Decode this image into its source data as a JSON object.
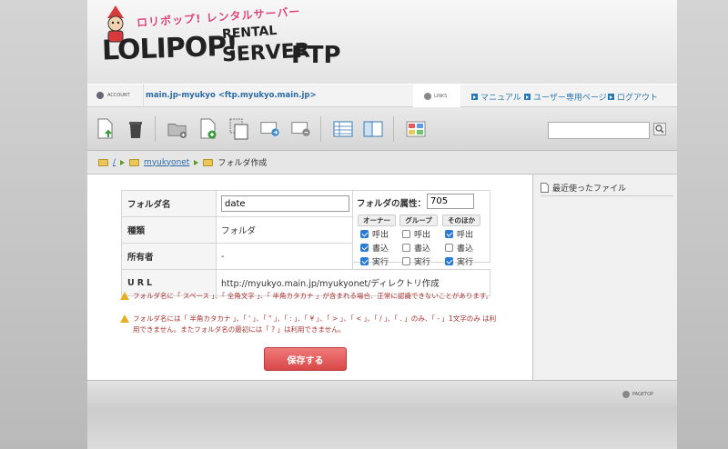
{
  "header": {
    "logo_tag": "ロリポップ! レンタルサーバー",
    "logo_main": "LOLIPOP!",
    "logo_rental": "RENTAL",
    "logo_server": "SERVER",
    "logo_ftp": "FTP"
  },
  "account": {
    "label": "ACCOUNT",
    "name": "main.jp-myukyo <ftp.myukyo.main.jp>"
  },
  "links": {
    "label": "LINKS",
    "items": [
      "マニュアル",
      "ユーザー専用ページ",
      "ログアウト"
    ]
  },
  "toolbar": {
    "icons": [
      "upload-file-icon",
      "trash-icon",
      "new-folder-icon",
      "new-file-icon",
      "copy-icon",
      "move-icon",
      "rename-icon",
      "list-view-icon",
      "split-view-icon",
      "tile-view-icon"
    ],
    "search_value": ""
  },
  "breadcrumb": {
    "root": "/",
    "folder": "myukyonet",
    "current": "フォルダ作成"
  },
  "form": {
    "name_label": "フォルダ名",
    "name_value": "date",
    "type_label": "種類",
    "type_value": "フォルダ",
    "owner_label": "所有者",
    "owner_value": "-",
    "url_label": "URL",
    "url_value": "http://myukyo.main.jp/myukyonet/ディレクトリ作成",
    "attr_label": "フォルダの属性：",
    "attr_value": "705",
    "columns": [
      "オーナー",
      "グループ",
      "そのほか"
    ],
    "perm_labels": [
      "呼出",
      "書込",
      "実行"
    ],
    "permissions": {
      "owner": [
        true,
        true,
        true
      ],
      "group": [
        false,
        false,
        false
      ],
      "other": [
        true,
        false,
        true
      ]
    }
  },
  "warnings": [
    "フォルダ名に「 スペース 」、「 全角文字 」、「 半角カタカナ 」が含まれる場合、正常に認識できないことがあります。",
    "フォルダ名には「 半角カタカナ 」、「 ' 」、「 \" 」、「 : 」、「 ¥ 」、「 > 」、「 < 」、「 / 」、「 . 」のみ、「 - 」1文字のみ は利用できません。またフォルダ名の最初には「 ? 」は利用できません。"
  ],
  "save_label": "保存する",
  "sidebar": {
    "recent_title": "最近使ったファイル"
  },
  "footer": {
    "pagetop": "PAGETOP"
  }
}
